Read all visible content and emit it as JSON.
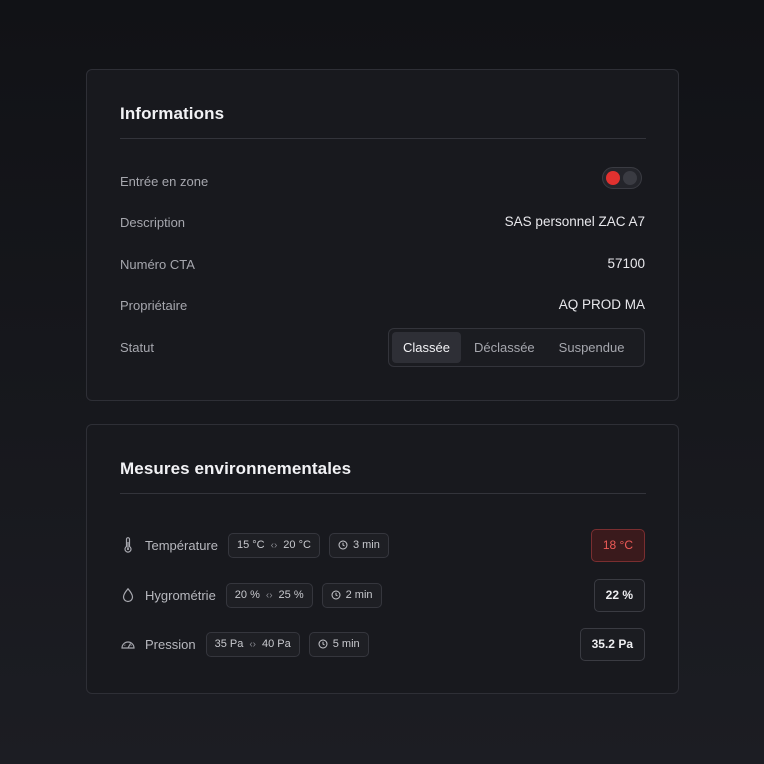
{
  "informations": {
    "title": "Informations",
    "entry_label": "Entrée en zone",
    "entry_enabled": true,
    "description_label": "Description",
    "description_value": "SAS personnel ZAC A7",
    "cta_label": "Numéro CTA",
    "cta_value": "57100",
    "owner_label": "Propriétaire",
    "owner_value": "AQ PROD MA",
    "status_label": "Statut",
    "status_options": [
      "Classée",
      "Déclassée",
      "Suspendue"
    ],
    "status_selected": "Classée"
  },
  "environment": {
    "title": "Mesures environnementales",
    "measures": [
      {
        "icon": "thermometer-icon",
        "label": "Température",
        "range_min": "15 °C",
        "range_max": "20 °C",
        "interval": "3 min",
        "value": "18 °C",
        "alert": true
      },
      {
        "icon": "droplet-icon",
        "label": "Hygrométrie",
        "range_min": "20 %",
        "range_max": "25 %",
        "interval": "2 min",
        "value": "22 %",
        "alert": false
      },
      {
        "icon": "gauge-icon",
        "label": "Pression",
        "range_min": "35 Pa",
        "range_max": "40 Pa",
        "interval": "5 min",
        "value": "35.2 Pa",
        "alert": false
      }
    ]
  },
  "colors": {
    "accent_red": "#e0312f",
    "alert_text": "#ee5a57"
  }
}
